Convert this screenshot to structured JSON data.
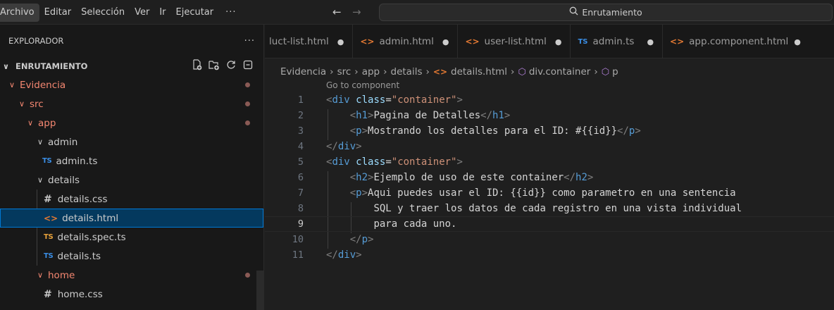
{
  "menu": [
    "Archivo",
    "Editar",
    "Selección",
    "Ver",
    "Ir",
    "Ejecutar",
    "···"
  ],
  "search": {
    "text": "Enrutamiento"
  },
  "explorer": {
    "title": "EXPLORADOR",
    "more": "···",
    "section": "ENRUTAMIENTO",
    "items": [
      {
        "label": "Evidencia"
      },
      {
        "label": "src"
      },
      {
        "label": "app"
      },
      {
        "label": "admin"
      },
      {
        "label": "admin.ts",
        "icon": "TS"
      },
      {
        "label": "details"
      },
      {
        "label": "details.css",
        "icon": "#"
      },
      {
        "label": "details.html",
        "icon": "<>"
      },
      {
        "label": "details.spec.ts",
        "icon": "TS"
      },
      {
        "label": "details.ts",
        "icon": "TS"
      },
      {
        "label": "home"
      },
      {
        "label": "home.css",
        "icon": "#"
      }
    ]
  },
  "tabs": [
    {
      "label": "luct-list.html",
      "modified": "●"
    },
    {
      "label": "admin.html",
      "modified": "●"
    },
    {
      "label": "user-list.html",
      "modified": "●"
    },
    {
      "label": "admin.ts",
      "modified": "●"
    },
    {
      "label": "app.component.html",
      "modified": "●"
    }
  ],
  "breadcrumb": [
    "Evidencia",
    "src",
    "app",
    "details",
    "details.html",
    "div.container",
    "p"
  ],
  "editor": {
    "codelens": "Go to component",
    "line_numbers": [
      "1",
      "2",
      "3",
      "4",
      "5",
      "6",
      "7",
      "8",
      "9",
      "10",
      "11"
    ],
    "current_line": 9,
    "lines": {
      "l1_attr": "class",
      "l1_val": "\"container\"",
      "l2_text": "Pagina de Detalles",
      "l3_text": "Mostrando los detalles para el ID: #{{id}}",
      "l5_attr": "class",
      "l5_val": "\"container\"",
      "l6_text": "Ejemplo de uso de este container",
      "l7_text": "Aqui puedes usar el ID: {{id}} como parametro en una sentencia",
      "l8_text": "SQL y traer los datos de cada registro en una vista individual",
      "l9_text": "para cada uno."
    }
  },
  "colors": {
    "accent": "#0078d4",
    "folder_modified": "#f48771",
    "html_icon": "#e37933",
    "ts_icon": "#3a8ee6"
  }
}
